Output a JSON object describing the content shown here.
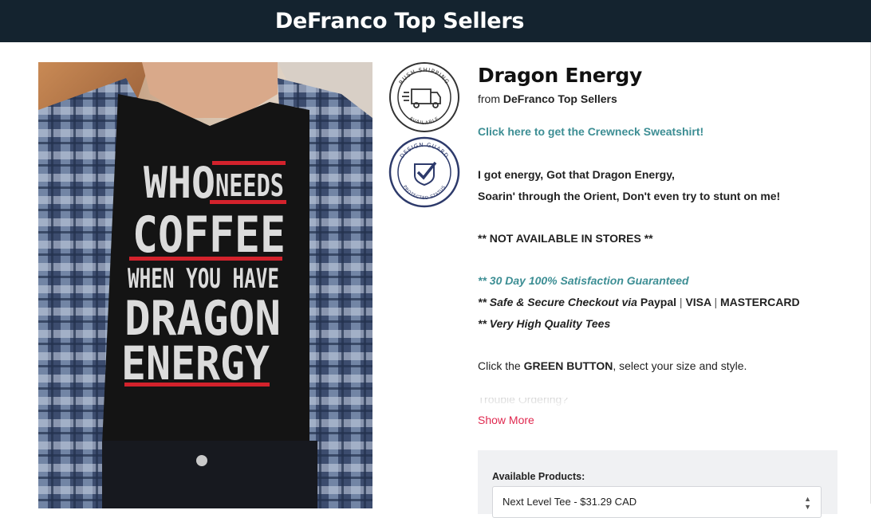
{
  "header": {
    "store_title": "DeFranco Top Sellers"
  },
  "image": {
    "shirt_text": [
      "WHO",
      "NEEDS",
      "COFFEE",
      "WHEN YOU HAVE",
      "DRAGON",
      "ENERGY"
    ]
  },
  "badges": {
    "rush": {
      "top_text": "RUSH SHIPPING",
      "bottom_text": "AVAILABLE"
    },
    "guard": {
      "top_text": "DESIGN GUARD",
      "bottom_text": "PROTECTED STATUS"
    }
  },
  "product": {
    "title": "Dragon Energy",
    "from_prefix": "from",
    "store": "DeFranco Top Sellers",
    "crewneck_link": "Click here to get the Crewneck Sweatshirt!",
    "lyrics_1": "I got energy, Got that Dragon Energy,",
    "lyrics_2": "Soarin' through the Orient, Don't even try to stunt on me!",
    "not_in_stores": "** NOT AVAILABLE IN STORES **",
    "guarantee": "** 30 Day 100% Satisfaction Guaranteed",
    "checkout_prefix": "** Safe & Secure Checkout via",
    "pay_paypal": "Paypal",
    "pay_sep": "|",
    "pay_visa": "VISA",
    "pay_master": "MASTERCARD",
    "quality": "** Very High Quality Tees",
    "click_prefix": "Click the",
    "click_button": "GREEN BUTTON",
    "click_suffix": ", select your size and style.",
    "faded_text": "Trouble Ordering?",
    "show_more": "Show More"
  },
  "products_panel": {
    "label": "Available Products:",
    "selected": "Next Level Tee - $31.29 CAD"
  },
  "colors": {
    "header_bg": "#14232f",
    "link_teal": "#3d8e94",
    "show_more_red": "#e0284f",
    "badge_navy": "#2d3a6b"
  }
}
